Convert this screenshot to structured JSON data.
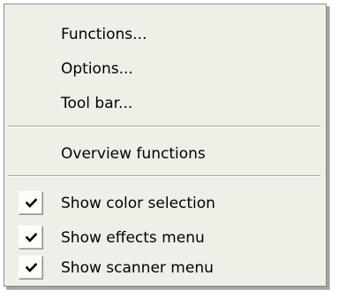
{
  "menu": {
    "items": [
      {
        "label": "Functions..."
      },
      {
        "label": "Options..."
      },
      {
        "label": "Tool bar..."
      }
    ],
    "overview": {
      "label": "Overview functions"
    },
    "toggles": [
      {
        "label": "Show color selection",
        "checked": true
      },
      {
        "label": "Show effects menu",
        "checked": true
      },
      {
        "label": "Show scanner menu",
        "checked": true
      }
    ]
  },
  "icons": {
    "check": "checkmark-icon"
  },
  "colors": {
    "menu_background": "#f0efe7",
    "separator": "#aca899",
    "text": "#000000"
  }
}
